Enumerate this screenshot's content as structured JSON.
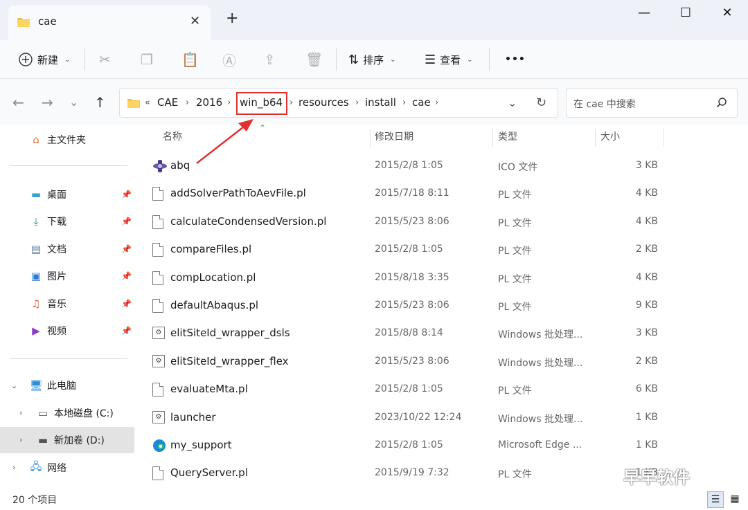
{
  "window": {
    "tab_title": "cae",
    "newtab_glyph": "+",
    "minimize_glyph": "—",
    "maximize_glyph": "☐",
    "close_glyph": "✕",
    "tab_close_glyph": "✕"
  },
  "toolbar": {
    "new_label": "新建",
    "sort_label": "排序",
    "view_label": "查看",
    "more_glyph": "•••"
  },
  "address": {
    "overflow_glyph": "«",
    "crumbs": [
      "CAE",
      "2016",
      "win_b64",
      "resources",
      "install",
      "cae"
    ],
    "highlighted_crumb": "win_b64"
  },
  "search": {
    "placeholder": "在 cae 中搜索"
  },
  "sidebar": {
    "home": "主文件夹",
    "quick": [
      {
        "label": "桌面",
        "icon": "desktop-icon"
      },
      {
        "label": "下载",
        "icon": "download-icon"
      },
      {
        "label": "文档",
        "icon": "document-icon"
      },
      {
        "label": "图片",
        "icon": "picture-icon"
      },
      {
        "label": "音乐",
        "icon": "music-icon"
      },
      {
        "label": "视频",
        "icon": "video-icon"
      }
    ],
    "this_pc": "此电脑",
    "drive_c": "本地磁盘 (C:)",
    "drive_d": "新加卷 (D:)",
    "network": "网络"
  },
  "columns": {
    "name": "名称",
    "date": "修改日期",
    "type": "类型",
    "size": "大小"
  },
  "files": [
    {
      "name": "abq",
      "date": "2015/2/8 1:05",
      "type": "ICO 文件",
      "size": "3 KB",
      "icon": "abaqus-icon"
    },
    {
      "name": "addSolverPathToAevFile.pl",
      "date": "2015/7/18 8:11",
      "type": "PL 文件",
      "size": "4 KB",
      "icon": "file-icon"
    },
    {
      "name": "calculateCondensedVersion.pl",
      "date": "2015/5/23 8:06",
      "type": "PL 文件",
      "size": "4 KB",
      "icon": "file-icon"
    },
    {
      "name": "compareFiles.pl",
      "date": "2015/2/8 1:05",
      "type": "PL 文件",
      "size": "2 KB",
      "icon": "file-icon"
    },
    {
      "name": "compLocation.pl",
      "date": "2015/8/18 3:35",
      "type": "PL 文件",
      "size": "4 KB",
      "icon": "file-icon"
    },
    {
      "name": "defaultAbaqus.pl",
      "date": "2015/5/23 8:06",
      "type": "PL 文件",
      "size": "9 KB",
      "icon": "file-icon"
    },
    {
      "name": "elitSiteId_wrapper_dsls",
      "date": "2015/8/8 8:14",
      "type": "Windows 批处理...",
      "size": "3 KB",
      "icon": "batch-icon"
    },
    {
      "name": "elitSiteId_wrapper_flex",
      "date": "2015/5/23 8:06",
      "type": "Windows 批处理...",
      "size": "2 KB",
      "icon": "batch-icon"
    },
    {
      "name": "evaluateMta.pl",
      "date": "2015/2/8 1:05",
      "type": "PL 文件",
      "size": "6 KB",
      "icon": "file-icon"
    },
    {
      "name": "launcher",
      "date": "2023/10/22 12:24",
      "type": "Windows 批处理...",
      "size": "1 KB",
      "icon": "batch-icon"
    },
    {
      "name": "my_support",
      "date": "2015/2/8 1:05",
      "type": "Microsoft Edge ...",
      "size": "1 KB",
      "icon": "edge-icon"
    },
    {
      "name": "QueryServer.pl",
      "date": "2015/9/19 7:32",
      "type": "PL 文件",
      "size": "1 KB",
      "icon": "file-icon"
    }
  ],
  "status": {
    "count": "20 个项目"
  },
  "watermark": "早早软件",
  "colors": {
    "accent": "#0067c0",
    "highlight_box": "#e03030",
    "arrow": "#e03030"
  }
}
